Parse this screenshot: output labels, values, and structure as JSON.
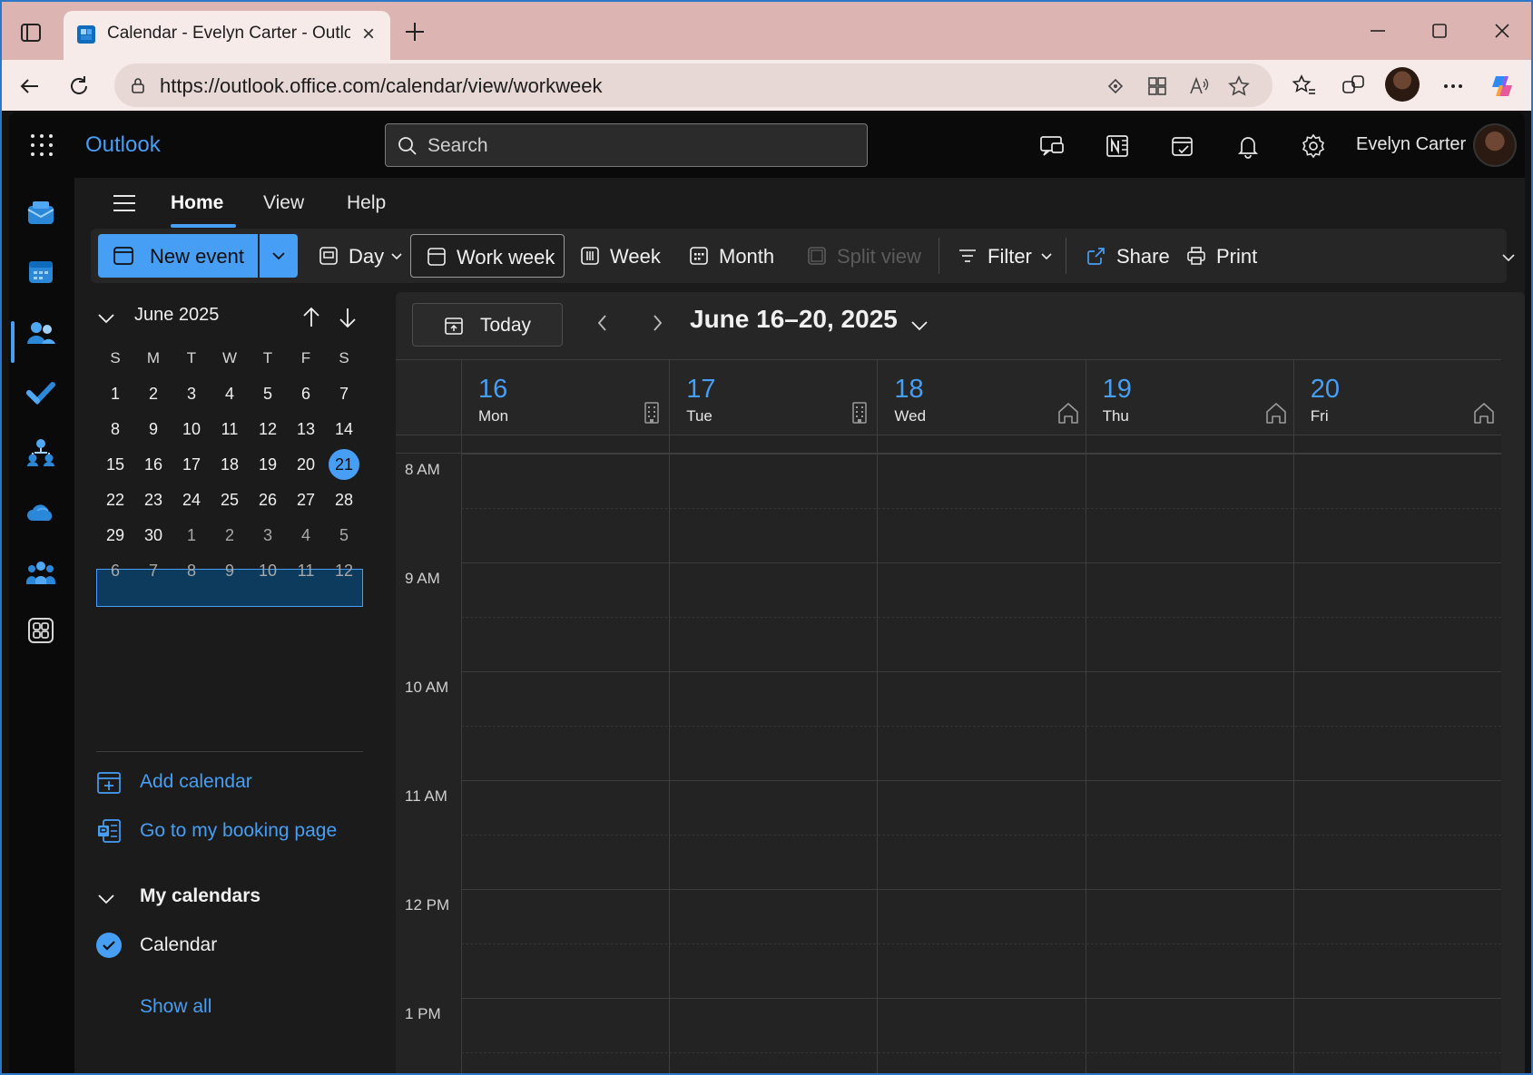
{
  "browser": {
    "tab_title": "Calendar - Evelyn Carter - Outlook",
    "url": "https://outlook.office.com/calendar/view/workweek"
  },
  "app": {
    "brand": "Outlook",
    "search_placeholder": "Search",
    "user_name": "Evelyn Carter",
    "accent_color": "#479ef5"
  },
  "ribbon": {
    "tabs": [
      {
        "label": "Home",
        "active": true
      },
      {
        "label": "View",
        "active": false
      },
      {
        "label": "Help",
        "active": false
      }
    ],
    "new_event": "New event",
    "views": {
      "day": "Day",
      "work_week": "Work week",
      "week": "Week",
      "month": "Month",
      "split_view": "Split view"
    },
    "filter": "Filter",
    "share": "Share",
    "print": "Print"
  },
  "mini_calendar": {
    "title": "June 2025",
    "days_of_week": [
      "S",
      "M",
      "T",
      "W",
      "T",
      "F",
      "S"
    ],
    "weeks": [
      [
        "1",
        "2",
        "3",
        "4",
        "5",
        "6",
        "7"
      ],
      [
        "8",
        "9",
        "10",
        "11",
        "12",
        "13",
        "14"
      ],
      [
        "15",
        "16",
        "17",
        "18",
        "19",
        "20",
        "21"
      ],
      [
        "22",
        "23",
        "24",
        "25",
        "26",
        "27",
        "28"
      ],
      [
        "29",
        "30",
        "1",
        "2",
        "3",
        "4",
        "5"
      ],
      [
        "6",
        "7",
        "8",
        "9",
        "10",
        "11",
        "12"
      ]
    ],
    "selected_week_index": 2,
    "today": "21"
  },
  "sidepane": {
    "add_calendar": "Add calendar",
    "booking_page": "Go to my booking page",
    "my_calendars": "My calendars",
    "calendar_item": "Calendar",
    "show_all": "Show all"
  },
  "calendar": {
    "today_button": "Today",
    "range_title": "June 16–20, 2025",
    "days": [
      {
        "num": "16",
        "name": "Mon",
        "location": "office-building-icon"
      },
      {
        "num": "17",
        "name": "Tue",
        "location": "office-building-icon"
      },
      {
        "num": "18",
        "name": "Wed",
        "location": "home-icon"
      },
      {
        "num": "19",
        "name": "Thu",
        "location": "home-icon"
      },
      {
        "num": "20",
        "name": "Fri",
        "location": "home-icon"
      }
    ],
    "time_labels": [
      "8 AM",
      "9 AM",
      "10 AM",
      "11 AM",
      "12 PM",
      "1 PM"
    ]
  }
}
